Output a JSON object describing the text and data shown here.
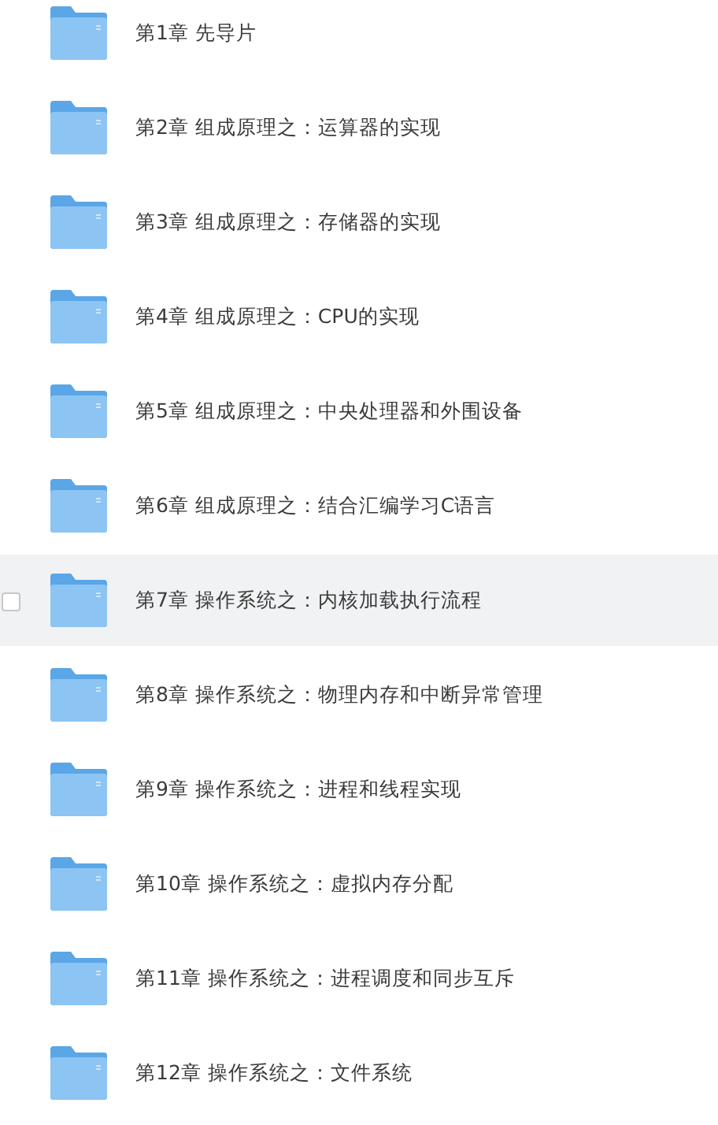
{
  "folders": [
    {
      "name": "第1章 先导片",
      "highlighted": false
    },
    {
      "name": "第2章 组成原理之：运算器的实现",
      "highlighted": false
    },
    {
      "name": "第3章 组成原理之：存储器的实现",
      "highlighted": false
    },
    {
      "name": "第4章 组成原理之：CPU的实现",
      "highlighted": false
    },
    {
      "name": "第5章 组成原理之：中央处理器和外围设备",
      "highlighted": false
    },
    {
      "name": "第6章 组成原理之：结合汇编学习C语言",
      "highlighted": false
    },
    {
      "name": "第7章 操作系统之：内核加载执行流程",
      "highlighted": true
    },
    {
      "name": "第8章 操作系统之：物理内存和中断异常管理",
      "highlighted": false
    },
    {
      "name": "第9章 操作系统之：进程和线程实现",
      "highlighted": false
    },
    {
      "name": "第10章 操作系统之：虚拟内存分配",
      "highlighted": false
    },
    {
      "name": "第11章 操作系统之：进程调度和同步互斥",
      "highlighted": false
    },
    {
      "name": "第12章 操作系统之：文件系统",
      "highlighted": false
    }
  ]
}
